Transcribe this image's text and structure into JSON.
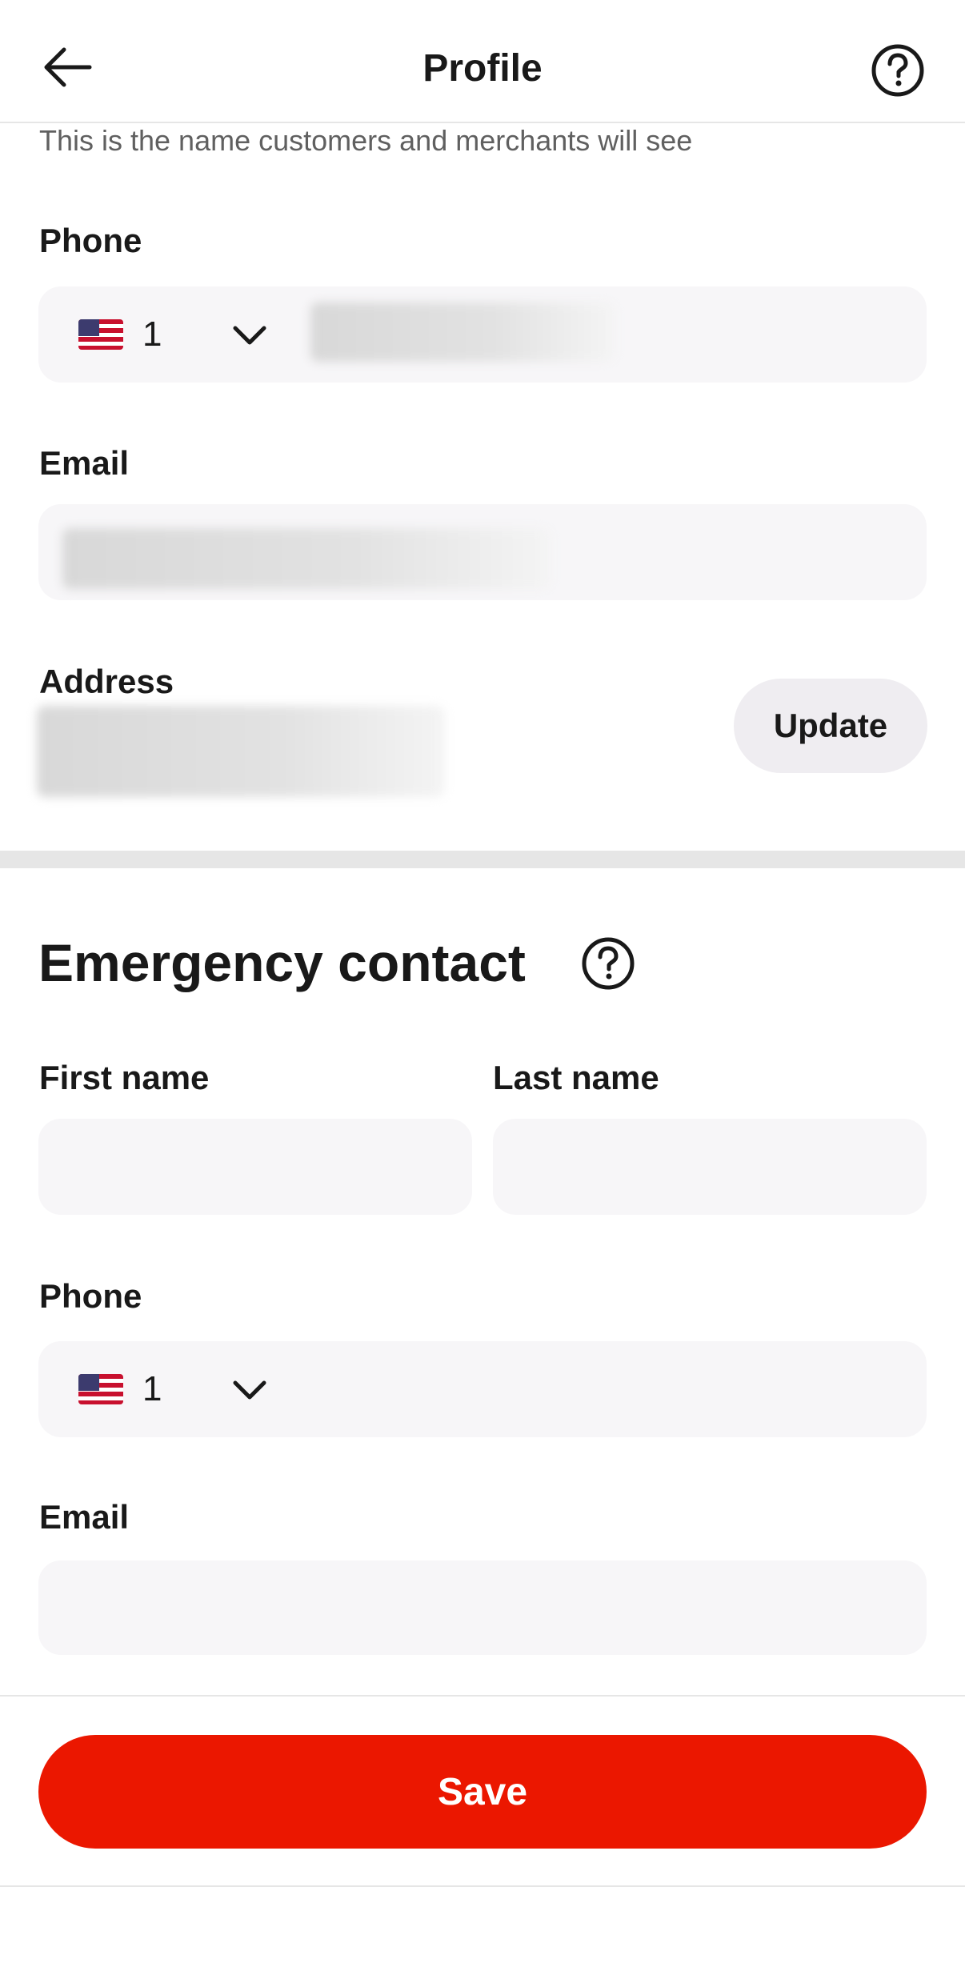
{
  "header": {
    "title": "Profile",
    "back_icon": "arrow-left-icon",
    "help_icon": "question-circle-icon"
  },
  "profile": {
    "name_hint": "This is the name customers and merchants will see",
    "phone_label": "Phone",
    "phone_country_code": "1",
    "email_label": "Email",
    "address_label": "Address",
    "update_label": "Update"
  },
  "emergency": {
    "title": "Emergency contact",
    "first_name_label": "First name",
    "last_name_label": "Last name",
    "first_name_value": "",
    "last_name_value": "",
    "phone_label": "Phone",
    "phone_country_code": "1",
    "phone_value": "",
    "email_label": "Email",
    "email_value": ""
  },
  "footer": {
    "save_label": "Save"
  },
  "colors": {
    "primary": "#eb1700",
    "field_bg": "#f7f6f8",
    "divider": "#e6e6e6"
  }
}
